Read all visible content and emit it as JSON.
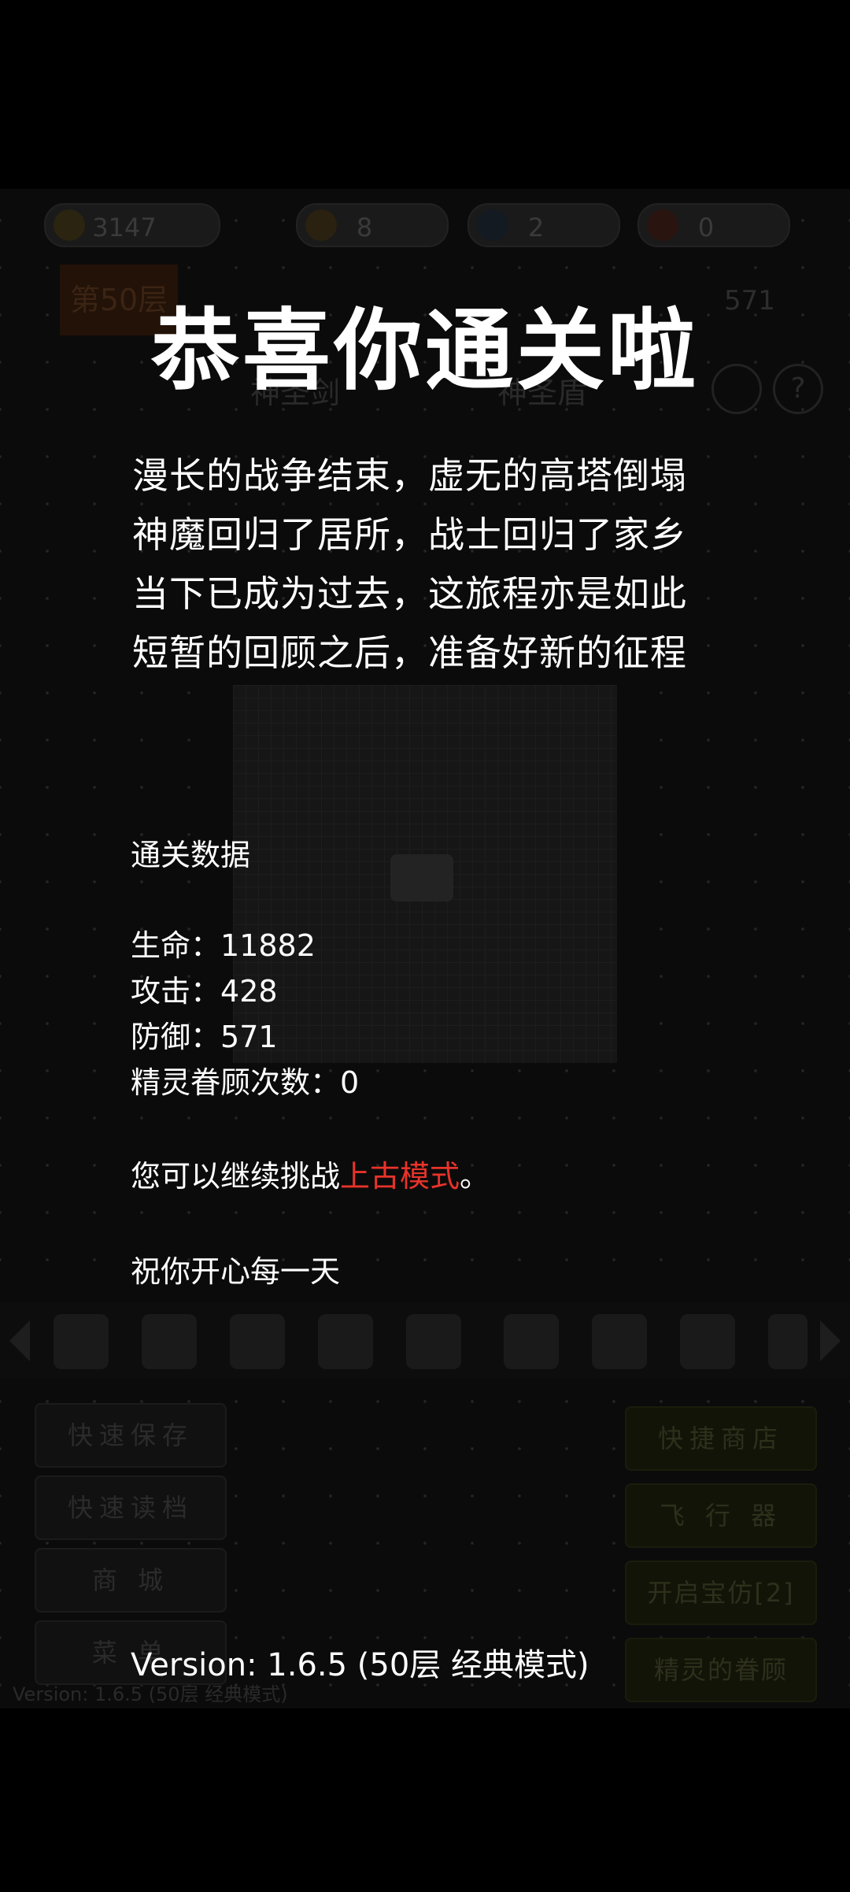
{
  "background": {
    "resources": [
      {
        "icon": "coin-icon",
        "value": "3147"
      },
      {
        "icon": "yellow-key-icon",
        "value": "8"
      },
      {
        "icon": "blue-key-icon",
        "value": "2"
      },
      {
        "icon": "red-key-icon",
        "value": "0"
      }
    ],
    "floor_label": "第50层",
    "sword_label": "神圣剑",
    "shield_label": "神圣盾",
    "defense_ghost": "571",
    "help_glyph": "?",
    "left_buttons": [
      "快速保存",
      "快速读档",
      "商 城",
      "菜 单"
    ],
    "right_buttons": [
      "快捷商店",
      "飞 行 器",
      "开启宝仿[2]",
      "精灵的眷顾"
    ],
    "ghost_version": "Version: 1.6.5 (50层 经典模式)"
  },
  "overlay": {
    "title": "恭喜你通关啦",
    "poem": [
      "漫长的战争结束，虚无的高塔倒塌",
      "神魔回归了居所，战士回归了家乡",
      "当下已成为过去，这旅程亦是如此",
      "短暂的回顾之后，准备好新的征程"
    ],
    "stats_heading": "通关数据",
    "life_label": "生命：",
    "life_value": "11882",
    "attack_label": "攻击：",
    "attack_value": "428",
    "defense_label": "防御：",
    "defense_value": "571",
    "spirit_label": "精灵眷顾次数：",
    "spirit_value": "0",
    "continue_prefix": "您可以继续挑战",
    "continue_mode": "上古模式",
    "continue_suffix": "。",
    "wish": "祝你开心每一天",
    "version": "Version: 1.6.5 (50层 经典模式)"
  },
  "colors": {
    "background": "#000000",
    "text": "#ffffff",
    "highlight": "#e8332a"
  }
}
